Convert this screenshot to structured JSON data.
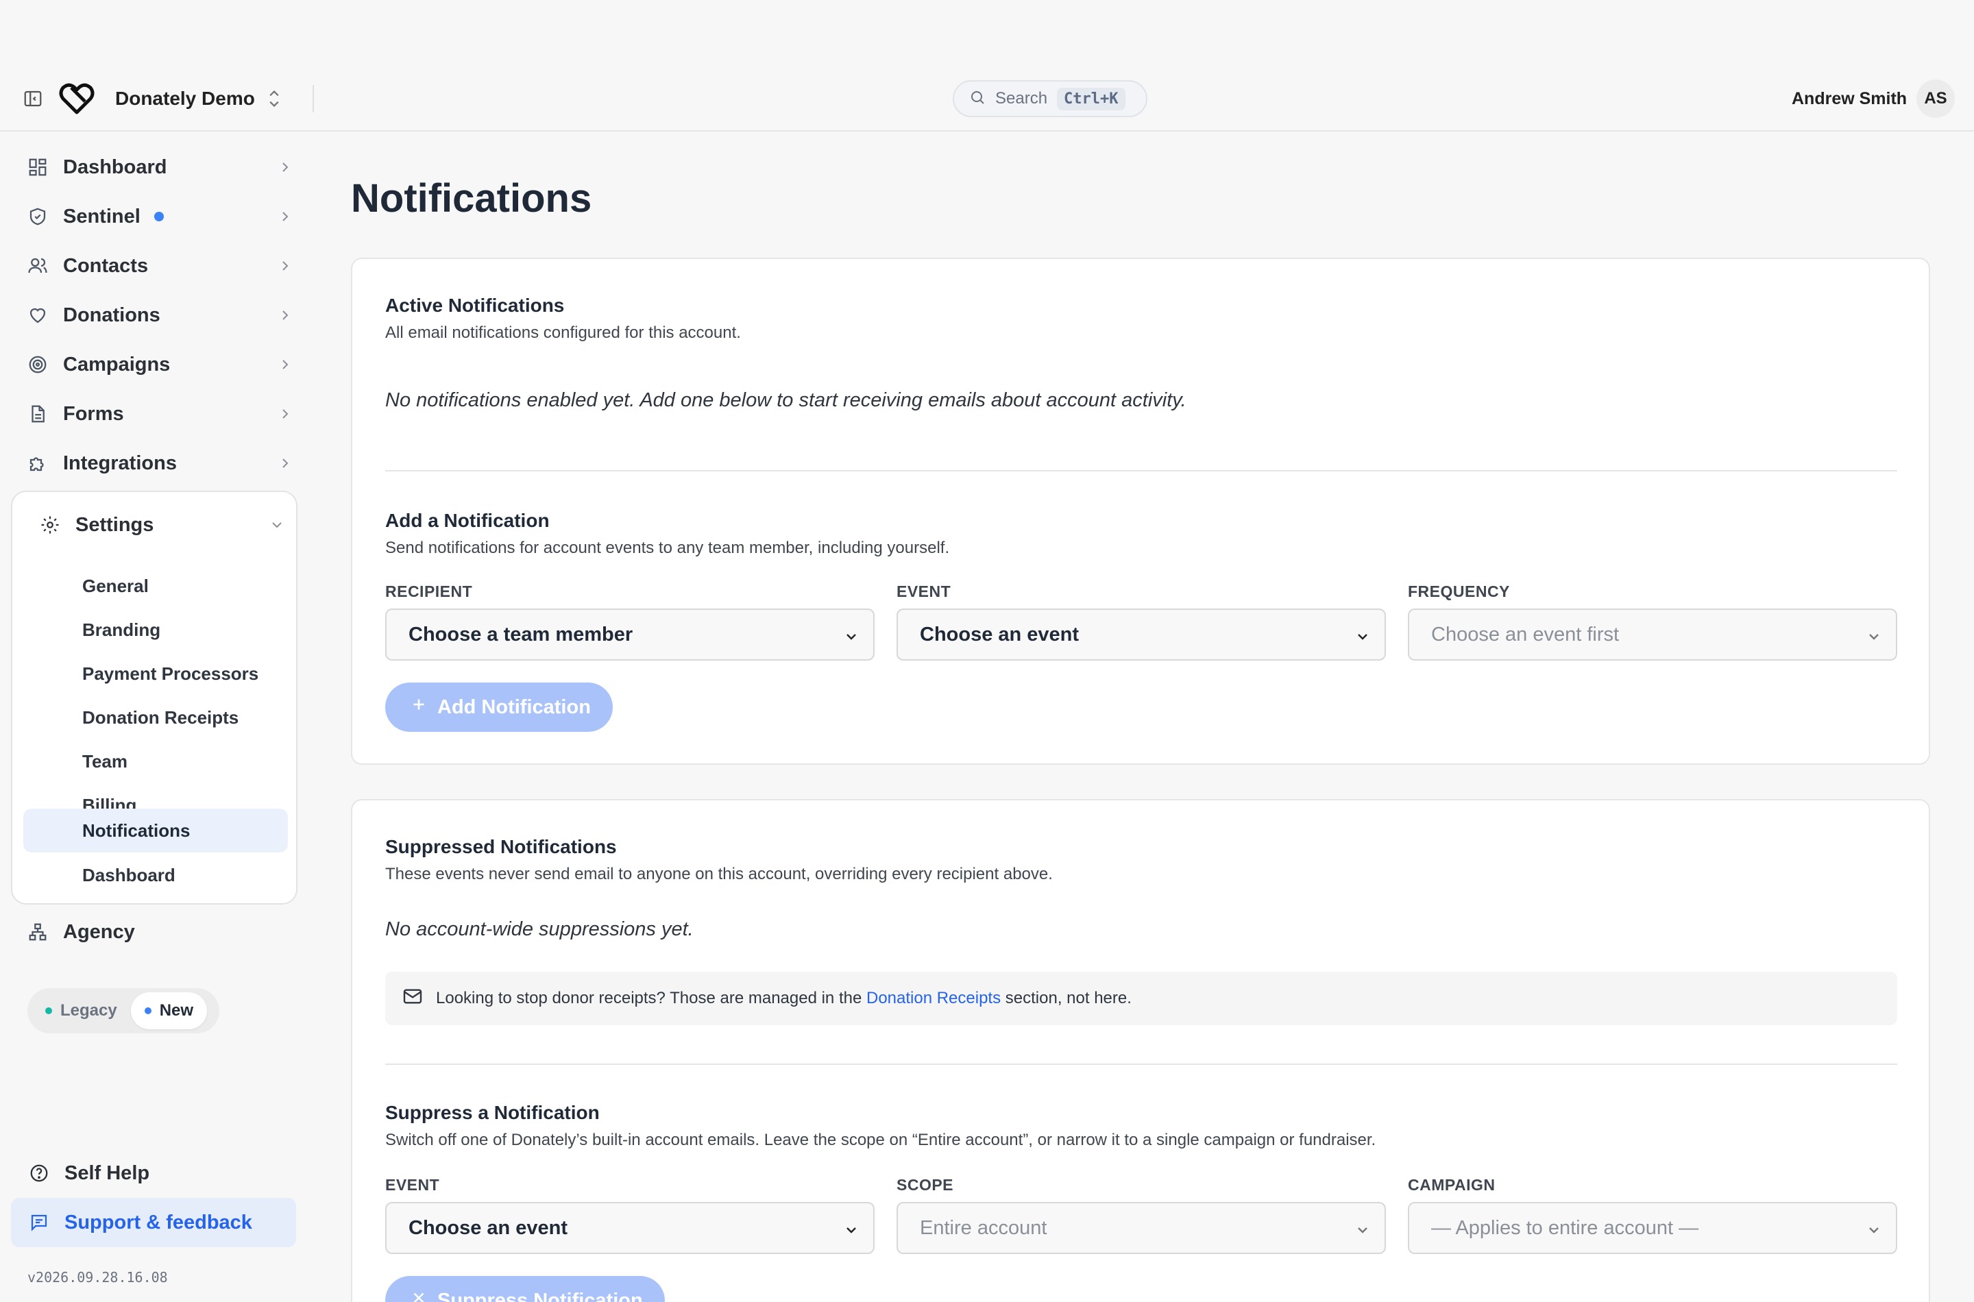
{
  "header": {
    "org_name": "Donately Demo",
    "search_label": "Search",
    "search_shortcut": "Ctrl+K",
    "user_name": "Andrew Smith",
    "user_initials": "AS"
  },
  "sidebar": {
    "items": [
      {
        "label": "Dashboard",
        "icon": "grid-icon"
      },
      {
        "label": "Sentinel",
        "icon": "shield-icon",
        "badge_dot": true
      },
      {
        "label": "Contacts",
        "icon": "users-icon"
      },
      {
        "label": "Donations",
        "icon": "heart-icon"
      },
      {
        "label": "Campaigns",
        "icon": "target-icon"
      },
      {
        "label": "Forms",
        "icon": "document-icon"
      },
      {
        "label": "Integrations",
        "icon": "puzzle-icon"
      }
    ],
    "settings": {
      "label": "Settings",
      "subitems": [
        "General",
        "Branding",
        "Payment Processors",
        "Donation Receipts",
        "Team",
        "Billing",
        "Notifications",
        "Dashboard"
      ],
      "active": "Notifications"
    },
    "agency_label": "Agency",
    "toggle": {
      "legacy": "Legacy",
      "new": "New",
      "selected": "New"
    },
    "self_help": "Self Help",
    "support": "Support & feedback",
    "version": "v2026.09.28.16.08"
  },
  "page": {
    "title": "Notifications",
    "active_section": {
      "title": "Active Notifications",
      "description": "All email notifications configured for this account.",
      "empty": "No notifications enabled yet. Add one below to start receiving emails about account activity."
    },
    "add_section": {
      "title": "Add a Notification",
      "description": "Send notifications for account events to any team member, including yourself.",
      "recipient_label": "RECIPIENT",
      "recipient_value": "Choose a team member",
      "event_label": "EVENT",
      "event_value": "Choose an event",
      "frequency_label": "FREQUENCY",
      "frequency_value": "Choose an event first",
      "button": "Add Notification"
    },
    "suppressed_section": {
      "title": "Suppressed Notifications",
      "description": "These events never send email to anyone on this account, overriding every recipient above.",
      "empty": "No account-wide suppressions yet.",
      "info_prefix": "Looking to stop donor receipts? Those are managed in the",
      "info_link": "Donation Receipts",
      "info_suffix": "section, not here."
    },
    "suppress_section": {
      "title": "Suppress a Notification",
      "description": "Switch off one of Donately’s built-in account emails. Leave the scope on “Entire account”, or narrow it to a single campaign or fundraiser.",
      "event_label": "EVENT",
      "event_value": "Choose an event",
      "scope_label": "SCOPE",
      "scope_value": "Entire account",
      "campaign_label": "CAMPAIGN",
      "campaign_value": "— Applies to entire account —",
      "button": "Suppress Notification"
    }
  },
  "colors": {
    "accent": "#3b82f6",
    "button_disabled": "#a9c3fa",
    "active_nav_bg": "#eaf1fd",
    "link": "#2563eb"
  }
}
